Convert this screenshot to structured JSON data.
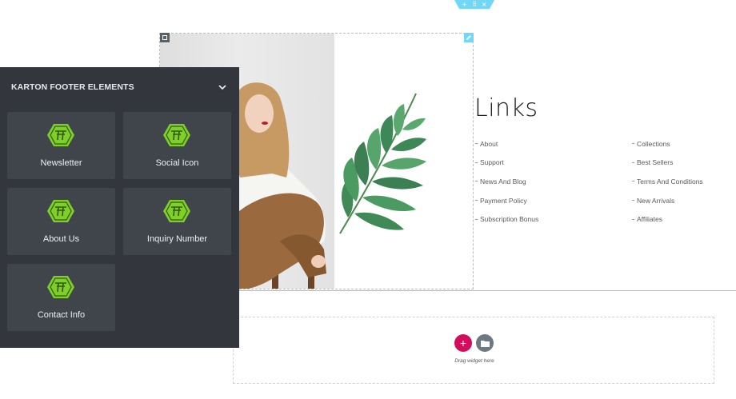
{
  "section_handle": {
    "add": "+",
    "move": "⠿",
    "close": "×"
  },
  "panel": {
    "title": "KARTON FOOTER ELEMENTS",
    "widgets": [
      {
        "label": "Newsletter"
      },
      {
        "label": "Social Icon"
      },
      {
        "label": "About Us"
      },
      {
        "label": "Inquiry Number"
      },
      {
        "label": "Contact Info"
      }
    ]
  },
  "links": {
    "heading": "Links",
    "left": [
      "About",
      "Support",
      "News And Blog",
      "Payment Policy",
      "Subscription Bonus"
    ],
    "right": [
      "Collections",
      "Best Sellers",
      "Terms And Conditions",
      "New Arrivals",
      "Affiliates"
    ]
  },
  "drop_zone": {
    "add_label": "+",
    "hint": "Drag widget here"
  },
  "colors": {
    "accent": "#71d7f7",
    "add_button": "#d30c5c",
    "panel_bg": "#33373d",
    "tile_bg": "#40444b",
    "widget_icon": "#7fcf28"
  }
}
